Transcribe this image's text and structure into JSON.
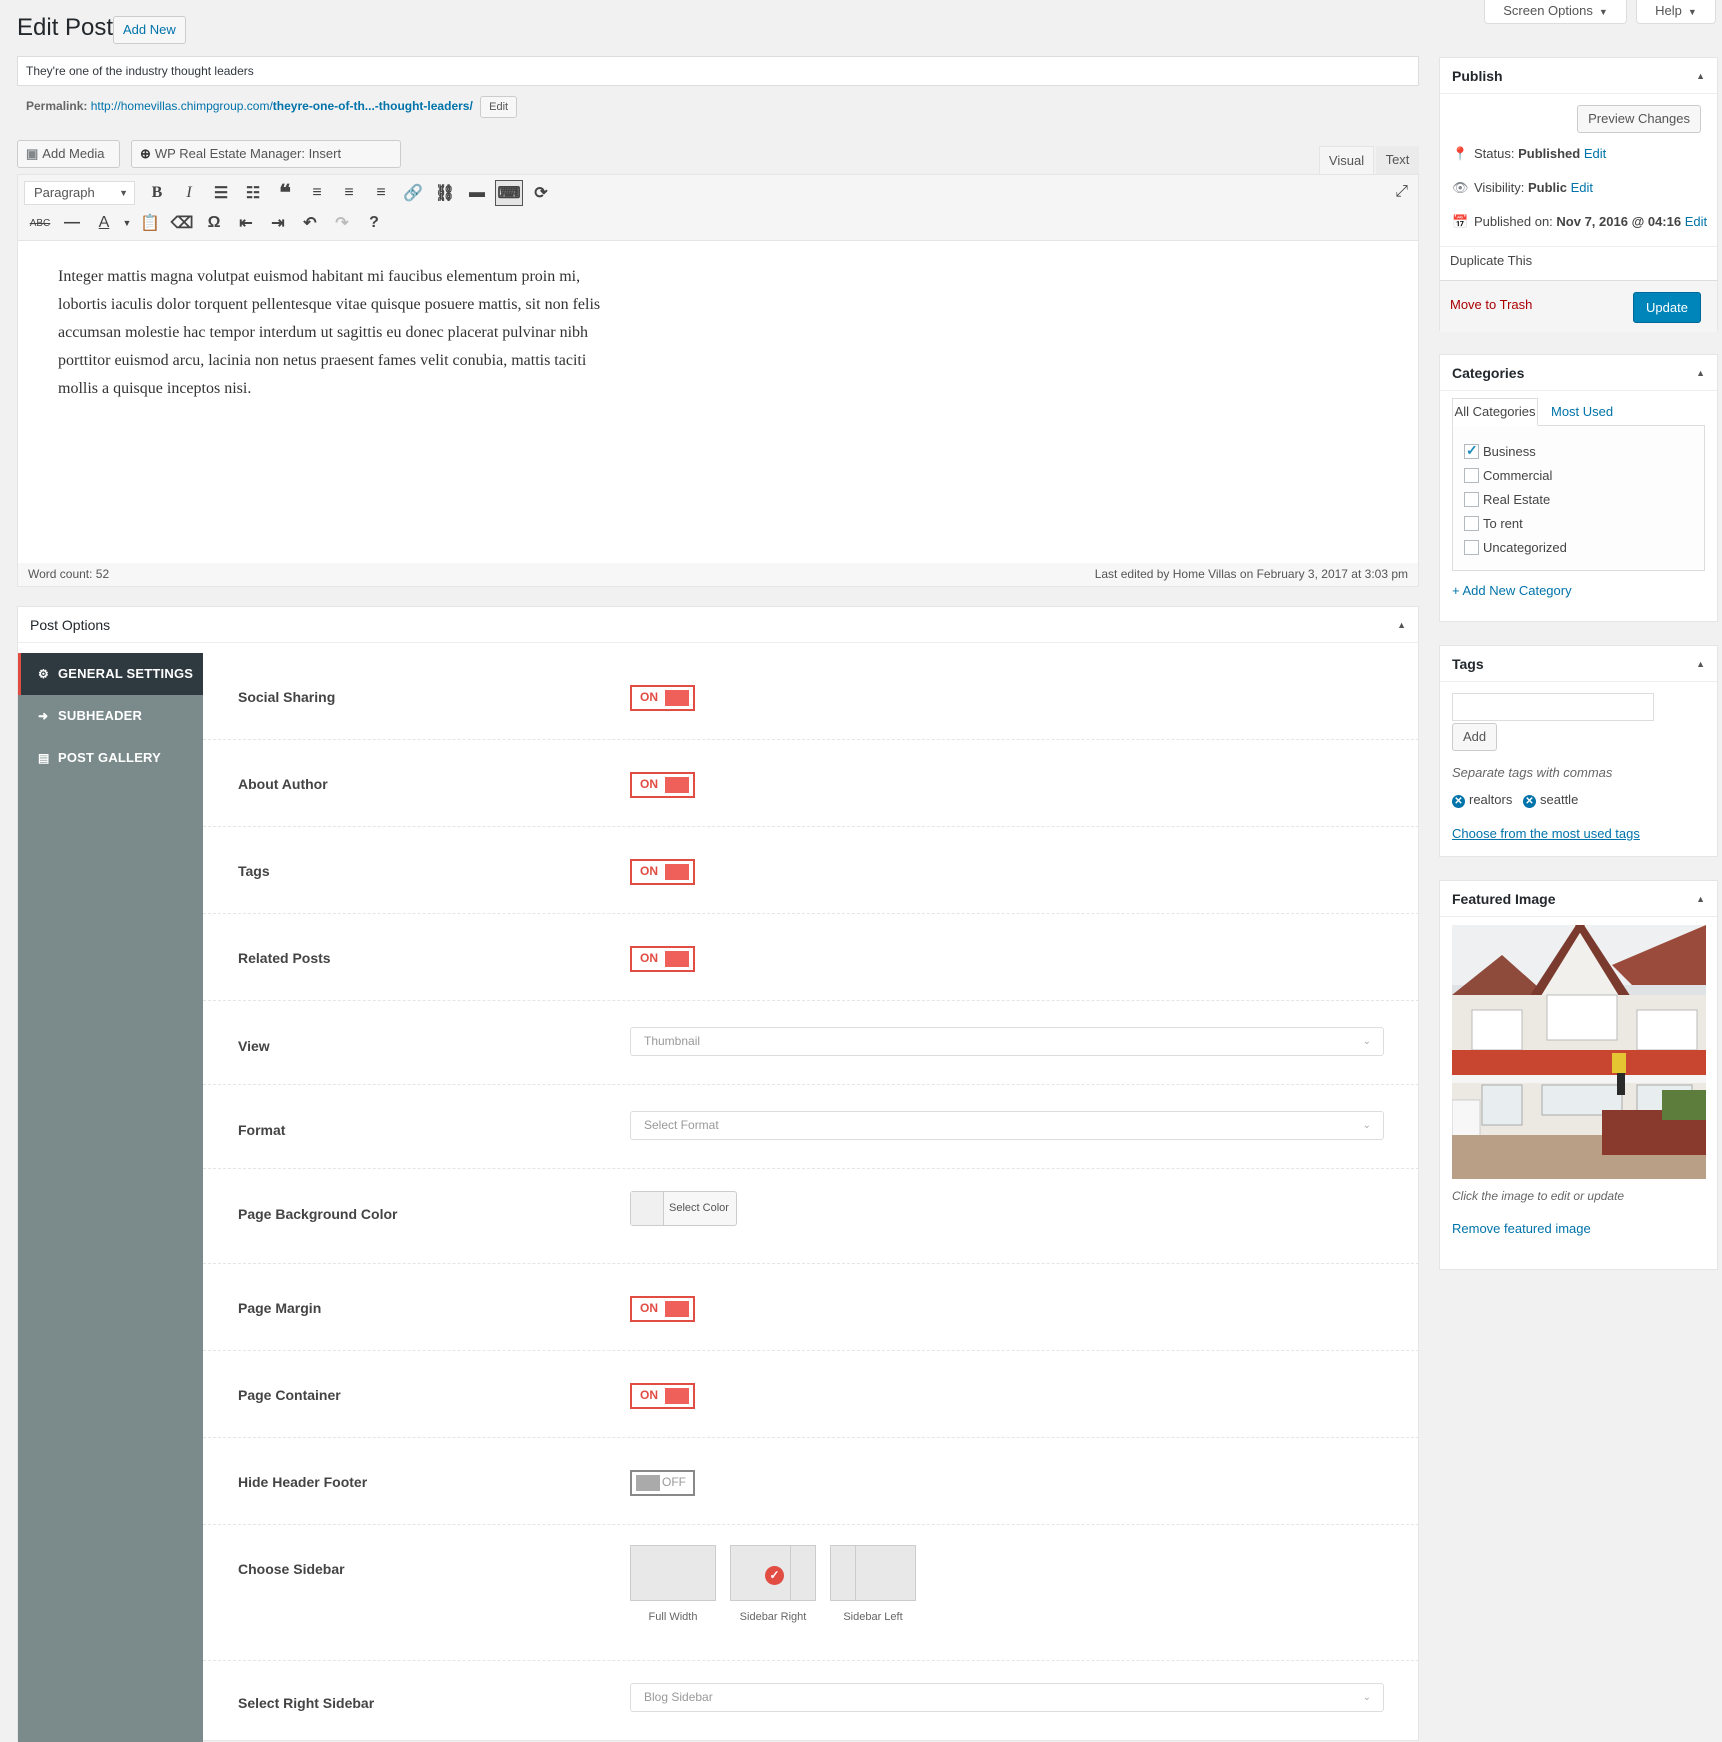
{
  "header": {
    "title": "Edit Post",
    "add_new": "Add New",
    "screen_options": "Screen Options",
    "help": "Help"
  },
  "post": {
    "title": "They're one of the industry thought leaders",
    "permalink_label": "Permalink:",
    "permalink_base": "http://homevillas.chimpgroup.com/",
    "permalink_slug": "theyre-one-of-th...-thought-leaders/",
    "permalink_edit": "Edit"
  },
  "media": {
    "add_media": "Add Media",
    "shortcode": "WP Real Estate Manager: Insert shortcode"
  },
  "editor_tabs": {
    "visual": "Visual",
    "text": "Text"
  },
  "toolbar": {
    "format_select": "Paragraph"
  },
  "editor": {
    "lines": [
      "Integer mattis magna volutpat euismod habitant mi faucibus elementum proin mi,",
      "lobortis iaculis dolor torquent pellentesque vitae quisque posuere mattis, sit non felis",
      "accumsan molestie hac tempor interdum ut sagittis eu donec placerat pulvinar nibh",
      "porttitor euismod arcu, lacinia non netus praesent fames velit conubia, mattis taciti",
      "mollis a quisque inceptos nisi."
    ],
    "path": "p",
    "word_count": "Word count: 52",
    "last_edited": "Last edited by Home Villas on February 3, 2017 at 3:03 pm"
  },
  "post_options": {
    "title": "Post Options",
    "nav": [
      {
        "label": "GENERAL SETTINGS",
        "icon": "gear-icon"
      },
      {
        "label": "SUBHEADER",
        "icon": "arrow-icon"
      },
      {
        "label": "POST GALLERY",
        "icon": "gallery-icon"
      }
    ],
    "fields": {
      "social_sharing": {
        "label": "Social Sharing",
        "state": "ON"
      },
      "about_author": {
        "label": "About Author",
        "state": "ON"
      },
      "tags": {
        "label": "Tags",
        "state": "ON"
      },
      "related_posts": {
        "label": "Related Posts",
        "state": "ON"
      },
      "view": {
        "label": "View",
        "value": "Thumbnail"
      },
      "format": {
        "label": "Format",
        "value": "Select Format"
      },
      "page_bg_color": {
        "label": "Page Background Color",
        "button": "Select Color"
      },
      "page_margin": {
        "label": "Page Margin",
        "state": "ON"
      },
      "page_container": {
        "label": "Page Container",
        "state": "ON"
      },
      "hide_header_footer": {
        "label": "Hide Header Footer",
        "state": "OFF"
      },
      "choose_sidebar": {
        "label": "Choose Sidebar",
        "options": [
          "Full Width",
          "Sidebar Right",
          "Sidebar Left"
        ],
        "selected": "Sidebar Right"
      },
      "select_right_sidebar": {
        "label": "Select Right Sidebar",
        "value": "Blog Sidebar"
      }
    }
  },
  "publish": {
    "title": "Publish",
    "preview": "Preview Changes",
    "status_label": "Status:",
    "status_value": "Published",
    "visibility_label": "Visibility:",
    "visibility_value": "Public",
    "published_label": "Published on:",
    "published_value": "Nov 7, 2016 @ 04:16",
    "edit": "Edit",
    "duplicate": "Duplicate This",
    "trash": "Move to Trash",
    "update": "Update"
  },
  "categories": {
    "title": "Categories",
    "tab_all": "All Categories",
    "tab_most_used": "Most Used",
    "items": [
      {
        "label": "Business",
        "checked": true
      },
      {
        "label": "Commercial",
        "checked": false
      },
      {
        "label": "Real Estate",
        "checked": false
      },
      {
        "label": "To rent",
        "checked": false
      },
      {
        "label": "Uncategorized",
        "checked": false
      }
    ],
    "add_new": "+ Add New Category"
  },
  "tags_box": {
    "title": "Tags",
    "add": "Add",
    "hint": "Separate tags with commas",
    "tags": [
      "realtors",
      "seattle"
    ],
    "choose": "Choose from the most used tags"
  },
  "featured_image": {
    "title": "Featured Image",
    "hint": "Click the image to edit or update",
    "remove": "Remove featured image"
  },
  "colors": {
    "accent_red": "#e14d43",
    "wp_blue": "#0073aa",
    "update_blue": "#0085ba",
    "nav_bg": "#7b8b8b",
    "nav_active": "#2e3a40"
  }
}
